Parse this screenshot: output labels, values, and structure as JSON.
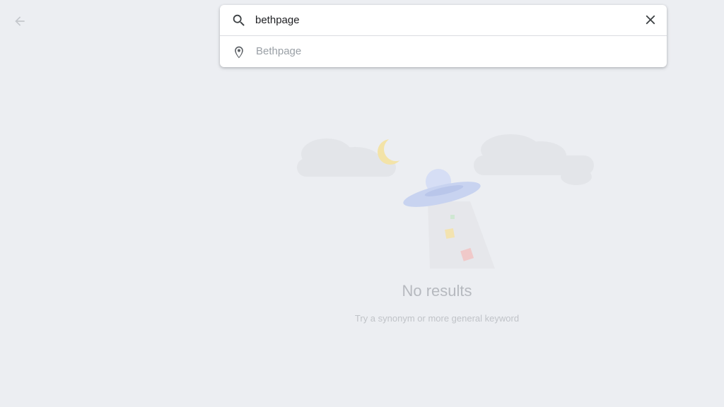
{
  "search": {
    "query": "bethpage",
    "suggestions": [
      {
        "label": "Bethpage",
        "icon": "location-pin-icon"
      }
    ]
  },
  "empty_state": {
    "title": "No results",
    "subtitle": "Try a synonym or more general keyword"
  },
  "colors": {
    "background": "#eceef2",
    "card": "#ffffff",
    "muted_text": "#9aa0a6",
    "ufo": "#c8d3f0",
    "moon": "#f3e3a8"
  }
}
